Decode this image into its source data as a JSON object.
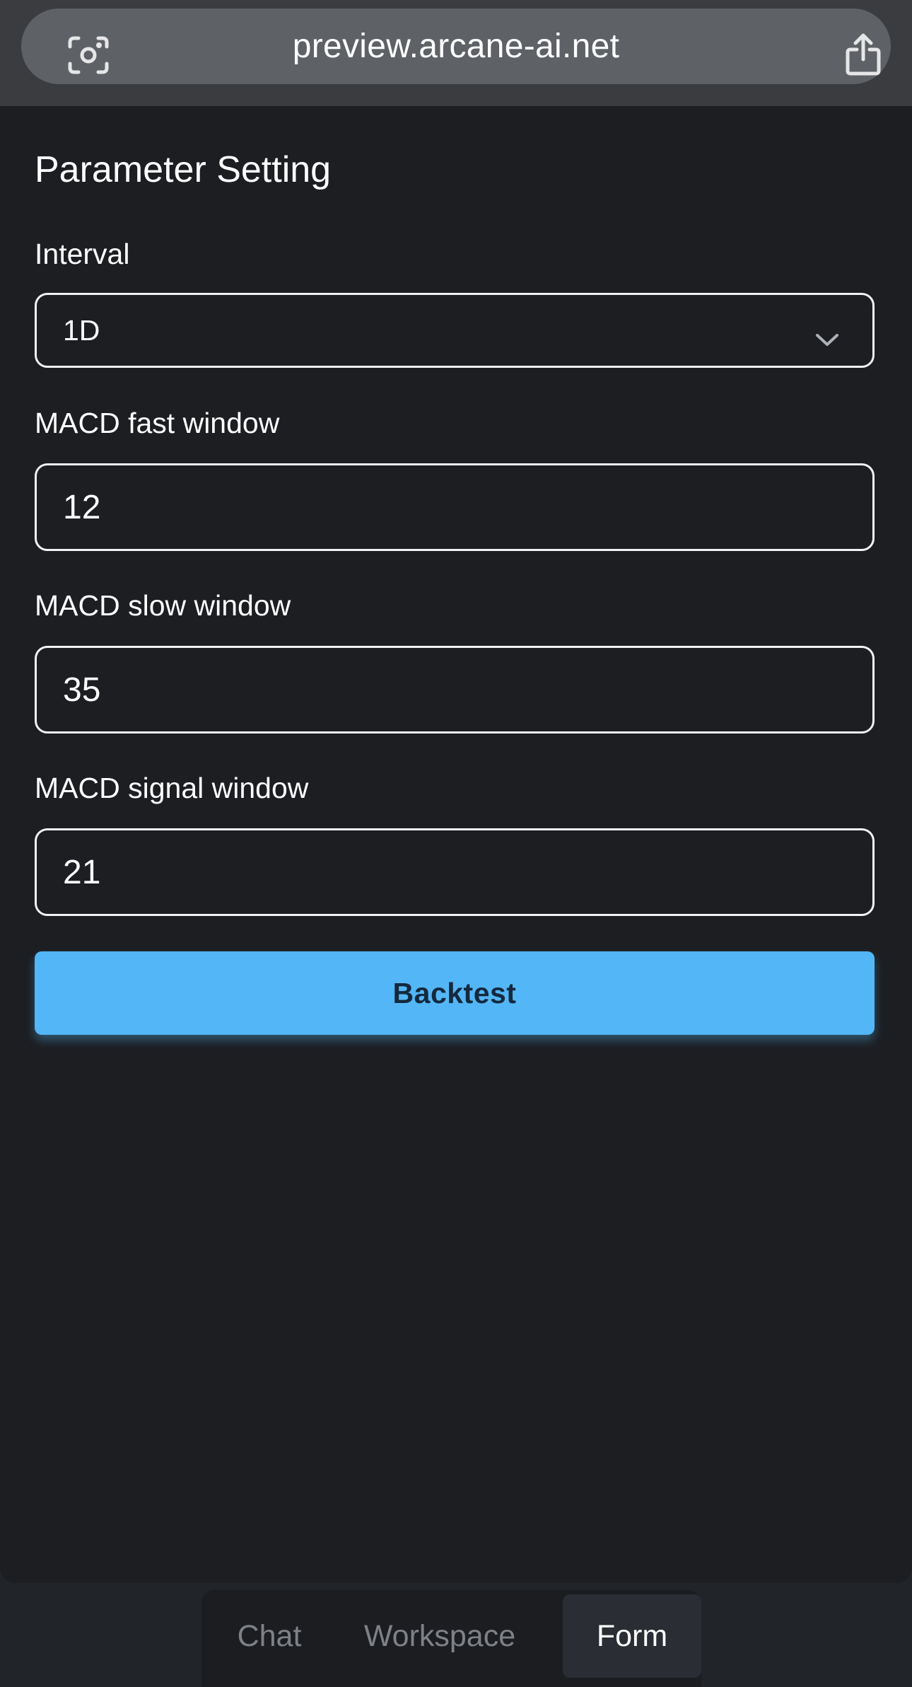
{
  "browser": {
    "url": "preview.arcane-ai.net",
    "left_icon": "scan-icon",
    "right_icon": "share-icon"
  },
  "form": {
    "title": "Parameter Setting",
    "interval": {
      "label": "Interval",
      "value": "1D",
      "icon": "chevron-down-icon"
    },
    "fast_window": {
      "label": "MACD fast window",
      "value": "12"
    },
    "slow_window": {
      "label": "MACD slow window",
      "value": "35"
    },
    "signal_window": {
      "label": "MACD signal window",
      "value": "21"
    },
    "submit_label": "Backtest",
    "accent_color": "#53b6f7"
  },
  "nav": {
    "tabs": [
      {
        "label": "Chat",
        "active": false
      },
      {
        "label": "Workspace",
        "active": false
      },
      {
        "label": "Form",
        "active": true
      }
    ]
  }
}
